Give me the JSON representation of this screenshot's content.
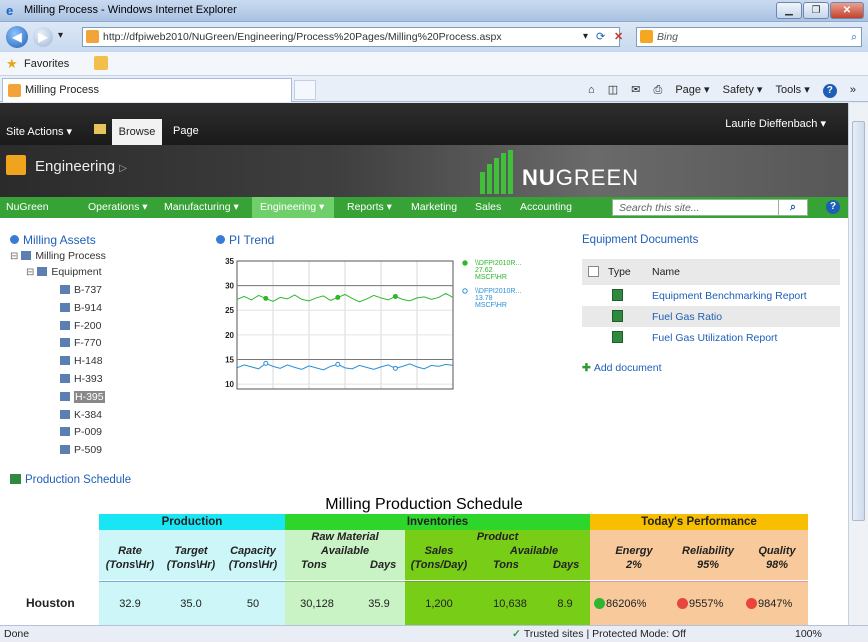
{
  "window": {
    "title": "Milling Process - Windows Internet Explorer",
    "min": "▁",
    "max": "❐",
    "close": "✕"
  },
  "browser": {
    "back": "◀",
    "forward": "▶",
    "dropdown": "▾",
    "url": "http://dfpiweb2010/NuGreen/Engineering/Process%20Pages/Milling%20Process.aspx",
    "refresh": "⟳",
    "stop": "✕",
    "search_placeholder": "Bing",
    "search_icon": "⌕",
    "favorites": "Favorites",
    "favorites_star": "★",
    "tab": "Milling Process",
    "commands": {
      "home": "⌂",
      "feeds": "◫",
      "mail": "✉",
      "print": "⎙",
      "page": "Page ▾",
      "safety": "Safety ▾",
      "tools": "Tools ▾",
      "help": "?",
      "more": "»"
    }
  },
  "sharepoint": {
    "site_actions": "Site Actions ▾",
    "ribbon_tabs": [
      "Browse",
      "Page"
    ],
    "user": "Laurie Dieffenbach ▾",
    "site_title": "Engineering",
    "site_title_arrow": "▷",
    "logo_bold": "NU",
    "logo_rest": "GREEN",
    "nav": [
      {
        "label": "NuGreen"
      },
      {
        "label": "Operations ▾"
      },
      {
        "label": "Manufacturing ▾"
      },
      {
        "label": "Engineering ▾"
      },
      {
        "label": "Reports ▾"
      },
      {
        "label": "Marketing"
      },
      {
        "label": "Sales"
      },
      {
        "label": "Accounting"
      }
    ],
    "search_placeholder": "Search this site...",
    "search_icon": "⌕",
    "help": "?"
  },
  "assets": {
    "title": "Milling Assets",
    "tree": {
      "root": "Milling Process",
      "group": "Equipment",
      "items": [
        "B-737",
        "B-914",
        "F-200",
        "F-770",
        "H-148",
        "H-393",
        "H-395",
        "K-384",
        "P-009",
        "P-509"
      ],
      "selected": "H-395",
      "expander": "⊟"
    }
  },
  "trend": {
    "title": "PI Trend",
    "legend": [
      {
        "tag": "\\\\DFPI2010R...",
        "value": "27.62",
        "unit": "MSCF\\HR",
        "color": "#2db82b"
      },
      {
        "tag": "\\\\DFPI2010R...",
        "value": "13.78",
        "unit": "MSCF\\HR",
        "color": "#2a8fd8"
      }
    ]
  },
  "chart_data": {
    "type": "line",
    "title": "PI Trend",
    "ylim": [
      9,
      35
    ],
    "yticks": [
      10,
      15,
      20,
      25,
      30,
      35
    ],
    "grid": true,
    "series": [
      {
        "name": "\\\\DFPI2010R...",
        "color": "#2db82b",
        "values": [
          27.2,
          27.8,
          27.1,
          28.0,
          27.4,
          26.8,
          27.6,
          27.3,
          28.1,
          27.2,
          26.9,
          27.5,
          27.9,
          27.0,
          27.6,
          28.2,
          27.4,
          26.7,
          27.3,
          28.0,
          27.5,
          27.1,
          27.8,
          27.2,
          26.9,
          27.5,
          27.7,
          27.2,
          27.6,
          28.4,
          27.6
        ]
      },
      {
        "name": "\\\\DFPI2010R...",
        "color": "#2a8fd8",
        "values": [
          13.3,
          13.9,
          13.5,
          13.1,
          14.2,
          13.6,
          13.2,
          13.9,
          13.4,
          13.0,
          13.7,
          13.3,
          12.9,
          13.6,
          14.0,
          13.3,
          13.1,
          13.8,
          13.4,
          13.0,
          13.5,
          13.9,
          13.2,
          13.6,
          14.1,
          13.5,
          13.1,
          13.8,
          13.6,
          14.0,
          13.8
        ]
      }
    ]
  },
  "documents": {
    "title": "Equipment Documents",
    "columns": [
      "Type",
      "Name"
    ],
    "items": [
      "Equipment Benchmarking Report",
      "Fuel Gas Ratio",
      "Fuel Gas Utilization Report"
    ],
    "add": "Add document",
    "add_icon": "✚"
  },
  "schedule": {
    "link": "Production Schedule",
    "title": "Milling Production Schedule",
    "groups": {
      "production": "Production",
      "inventories": "Inventories",
      "performance": "Today's Performance"
    },
    "subgroups": {
      "raw": "Raw Material",
      "raw2": "Available",
      "product": "Product",
      "product_available": "Available"
    },
    "headers": {
      "rate": "Rate",
      "rate_unit": "(Tons\\Hr)",
      "target": "Target",
      "target_unit": "(Tons\\Hr)",
      "capacity": "Capacity",
      "capacity_unit": "(Tons\\Hr)",
      "raw_tons": "Tons",
      "raw_days": "Days",
      "sales": "Sales",
      "sales_unit": "(Tons/Day)",
      "prod_tons": "Tons",
      "prod_days": "Days",
      "energy": "Energy",
      "energy_target": "2%",
      "reliability": "Reliability",
      "reliability_target": "95%",
      "quality": "Quality",
      "quality_target": "98%"
    },
    "rows": [
      {
        "site": "Houston",
        "rate": "32.9",
        "target": "35.0",
        "capacity": "50",
        "raw_tons": "30,128",
        "raw_days": "35.9",
        "sales": "1,200",
        "prod_tons": "10,638",
        "prod_days": "8.9",
        "energy": "86206%",
        "reliability": "9557%",
        "quality": "9847%"
      }
    ],
    "status_colors": {
      "energy": "#2fb52f",
      "reliability": "#e8453c",
      "quality": "#e8453c"
    }
  },
  "statusbar": {
    "left": "Done",
    "zone": "Trusted sites | Protected Mode: Off",
    "check": "✓",
    "zoom": "100%",
    "zoom_icon": "🔍"
  }
}
